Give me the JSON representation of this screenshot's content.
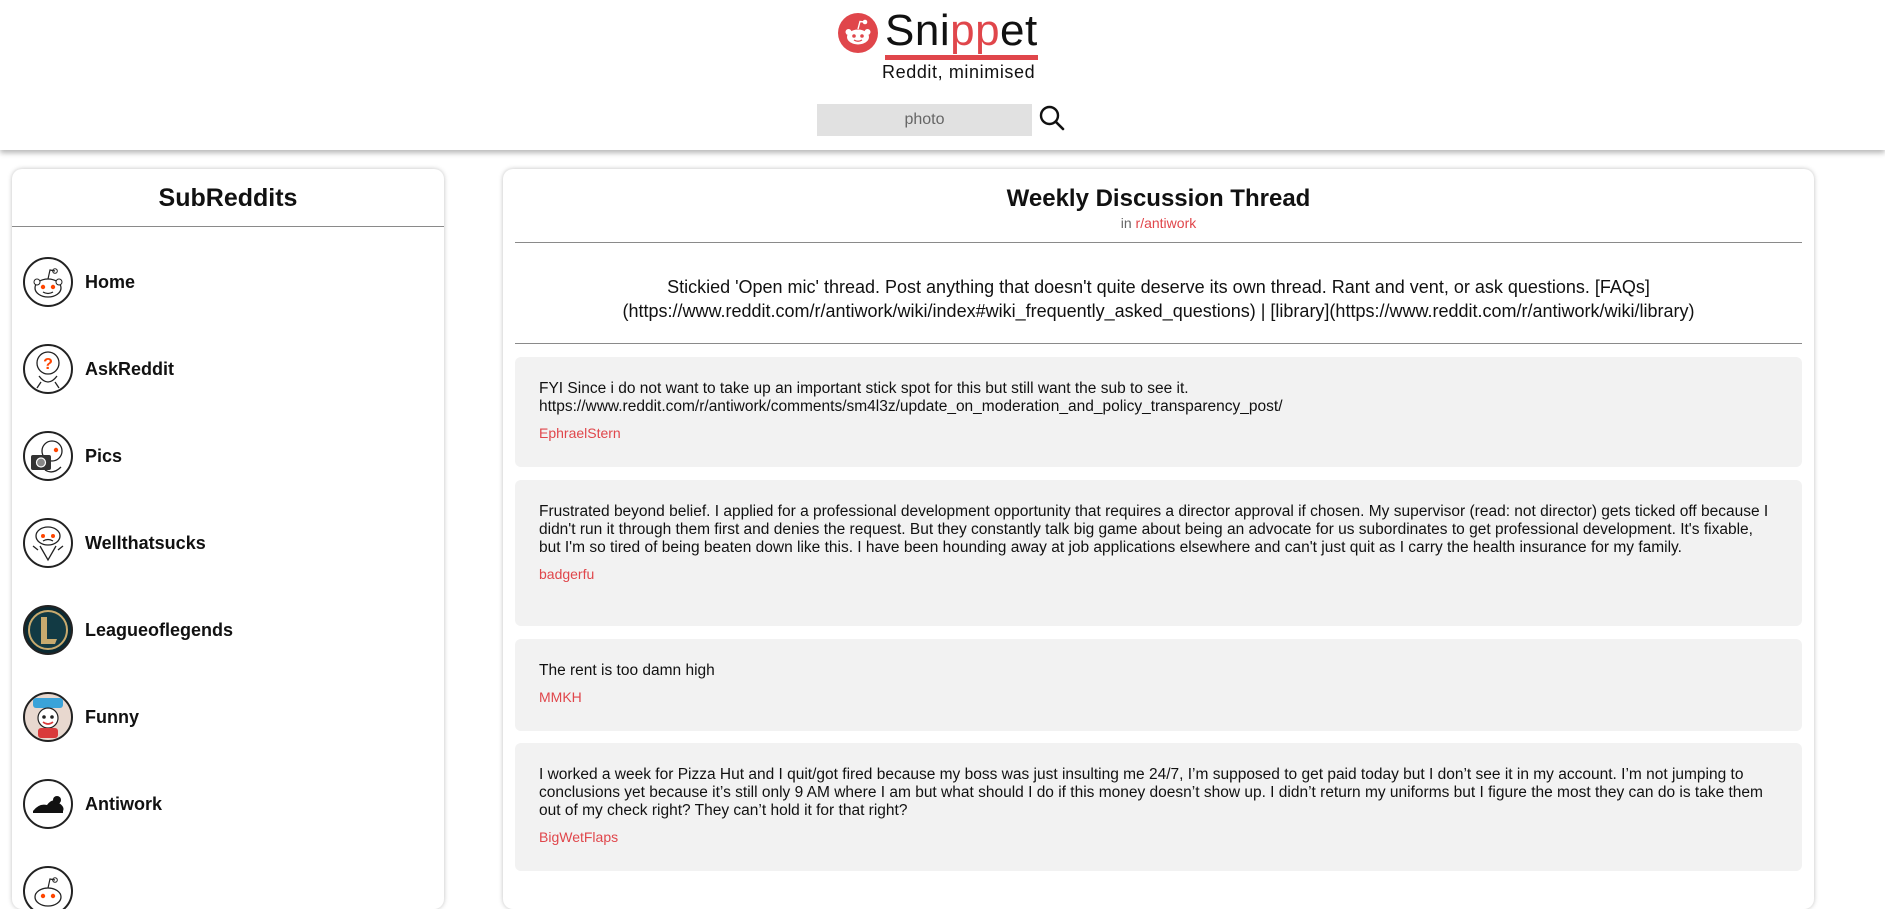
{
  "header": {
    "logo_part1": "Sni",
    "logo_accent": "pp",
    "logo_part2": "et",
    "tagline": "Reddit, minimised",
    "search": {
      "placeholder": "photo",
      "value": ""
    },
    "accent_color": "#e0464b"
  },
  "sidebar": {
    "title": "SubReddits",
    "items": [
      {
        "label": "Home",
        "icon": "reddit-alien-icon"
      },
      {
        "label": "AskReddit",
        "icon": "question-alien-icon"
      },
      {
        "label": "Pics",
        "icon": "camera-alien-icon"
      },
      {
        "label": "Wellthatsucks",
        "icon": "sad-alien-icon"
      },
      {
        "label": "Leagueoflegends",
        "icon": "league-logo-icon"
      },
      {
        "label": "Funny",
        "icon": "funny-mascot-icon"
      },
      {
        "label": "Antiwork",
        "icon": "antiwork-lounge-icon"
      },
      {
        "label": "",
        "icon": "reddit-alien-icon"
      }
    ]
  },
  "thread": {
    "title": "Weekly Discussion Thread",
    "in_prefix": "in ",
    "subreddit": "r/antiwork",
    "body": "Stickied 'Open mic' thread. Post anything that doesn't quite deserve its own thread. Rant and vent, or ask questions. [FAQs](https://www.reddit.com/r/antiwork/wiki/index#wiki_frequently_asked_questions) | [library](https://www.reddit.com/r/antiwork/wiki/library)"
  },
  "comments": [
    {
      "text": "FYI Since i do not want to take up an important stick spot for this but still want the sub to see it. https://www.reddit.com/r/antiwork/comments/sm4l3z/update_on_moderation_and_policy_transparency_post/",
      "author": "EphraelStern"
    },
    {
      "text": "Frustrated beyond belief. I applied for a professional development opportunity that requires a director approval if chosen. My supervisor (read: not director) gets ticked off because I didn't run it through them first and denies the request. But they constantly talk big game about being an advocate for us subordinates to get professional development. It's fixable, but I'm so tired of being beaten down like this. I have been hounding away at job applications elsewhere and can't just quit as I carry the health insurance for my family.",
      "author": "badgerfu"
    },
    {
      "text": "The rent is too damn high",
      "author": "MMKH"
    },
    {
      "text": "I worked a week for Pizza Hut and I quit/got fired because my boss was just insulting me 24/7, I’m supposed to get paid today but I don’t see it in my account. I’m not jumping to conclusions yet because it’s still only 9 AM where I am but what should I do if this money doesn’t show up. I didn’t return my uniforms but I figure the most they can do is take them out of my check right? They can’t hold it for that right?",
      "author": "BigWetFlaps"
    }
  ]
}
